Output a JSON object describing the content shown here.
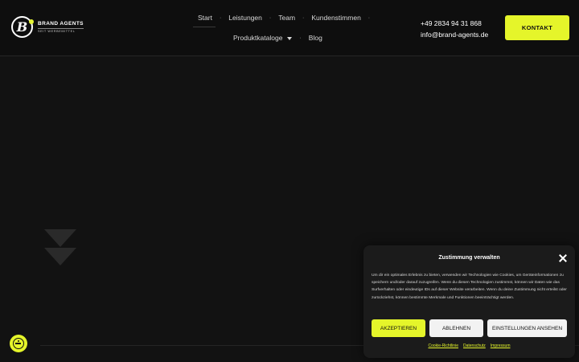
{
  "brand": {
    "name": "BRAND AGENTS",
    "tagline": "SEIT WERBEMITTEL",
    "logo_letter": "B"
  },
  "nav": {
    "row1": [
      "Start",
      "Leistungen",
      "Team",
      "Kundenstimmen"
    ],
    "row2": [
      "Produktkataloge",
      "Blog"
    ],
    "separator": "·"
  },
  "contact": {
    "phone": "+49 2834 94 31 868",
    "email": "info@brand-agents.de",
    "button_label": "KONTAKT"
  },
  "cookie": {
    "title": "Zustimmung verwalten",
    "body": "Um dir ein optimales Erlebnis zu bieten, verwenden wir Technologien wie Cookies, um Geräteinformationen zu speichern und/oder darauf zuzugreifen. Wenn du diesen Technologien zustimmst, können wir Daten wie das Surfverhalten oder eindeutige IDs auf dieser Website verarbeiten. Wenn du deine Zustimmung nicht erteilst oder zurückziehst, können bestimmte Merkmale und Funktionen beeinträchtigt werden.",
    "accept_label": "AKZEPTIEREN",
    "reject_label": "ABLEHNEN",
    "settings_label": "EINSTELLUNGEN ANSEHEN",
    "links": [
      "Cookie-Richtlinie",
      "Datenschutz",
      "Impressum"
    ]
  },
  "colors": {
    "accent": "#e5f52a",
    "background": "#121212",
    "header": "#0e0e0e"
  },
  "icons": [
    "brand-logo-icon",
    "chevron-down-icon",
    "down-arrows-icon",
    "close-icon",
    "accessibility-icon"
  ]
}
